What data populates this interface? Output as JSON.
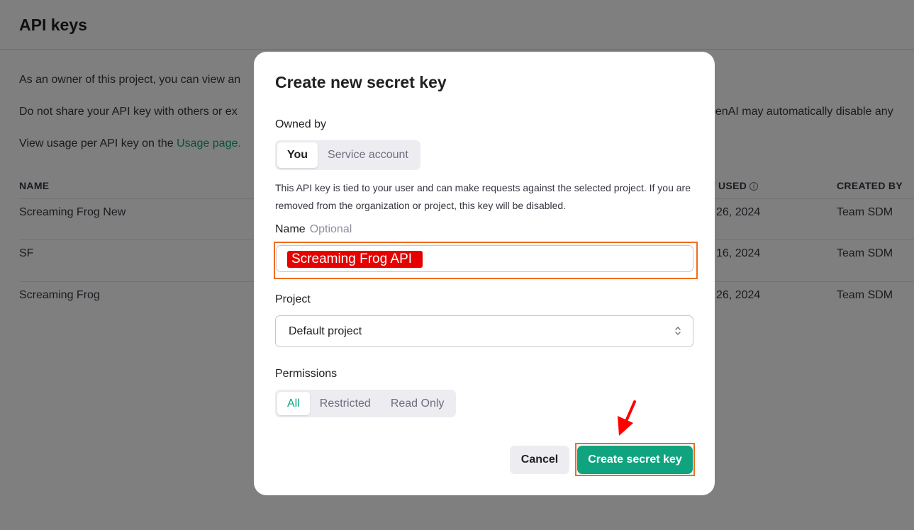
{
  "page": {
    "title": "API keys",
    "para1": "As an owner of this project, you can view an",
    "para2": "Do not share your API key with others or ex",
    "para2_right": "penAI may automatically disable any",
    "para3_prefix": "View usage per API key on the ",
    "para3_link": "Usage page.",
    "table": {
      "headers": {
        "name": "NAME",
        "last_used": "T USED",
        "created_by": "CREATED BY"
      },
      "rows": [
        {
          "name": "Screaming Frog New",
          "last_used": "26, 2024",
          "created_by": "Team SDM"
        },
        {
          "name": "SF",
          "last_used": "16, 2024",
          "created_by": "Team SDM"
        },
        {
          "name": "Screaming Frog",
          "last_used": "26, 2024",
          "created_by": "Team SDM"
        }
      ]
    }
  },
  "modal": {
    "title": "Create new secret key",
    "owned_by_label": "Owned by",
    "owner_options": [
      "You",
      "Service account"
    ],
    "owner_selected": "You",
    "owner_hint": "This API key is tied to your user and can make requests against the selected project. If you are removed from the organization or project, this key will be disabled.",
    "name_label": "Name",
    "name_optional": "Optional",
    "name_value": "Screaming Frog API",
    "project_label": "Project",
    "project_value": "Default project",
    "permissions_label": "Permissions",
    "permission_options": [
      "All",
      "Restricted",
      "Read Only"
    ],
    "permission_selected": "All",
    "cancel_label": "Cancel",
    "create_label": "Create secret key"
  },
  "icons": {
    "info": "info-icon",
    "chevron": "chevron-up-down-icon",
    "annotation_arrow": "red-arrow-icon"
  },
  "colors": {
    "accent": "#10a37f",
    "highlight_border": "#f06d1f",
    "name_highlight": "#e60000",
    "arrow": "#ff0000"
  }
}
